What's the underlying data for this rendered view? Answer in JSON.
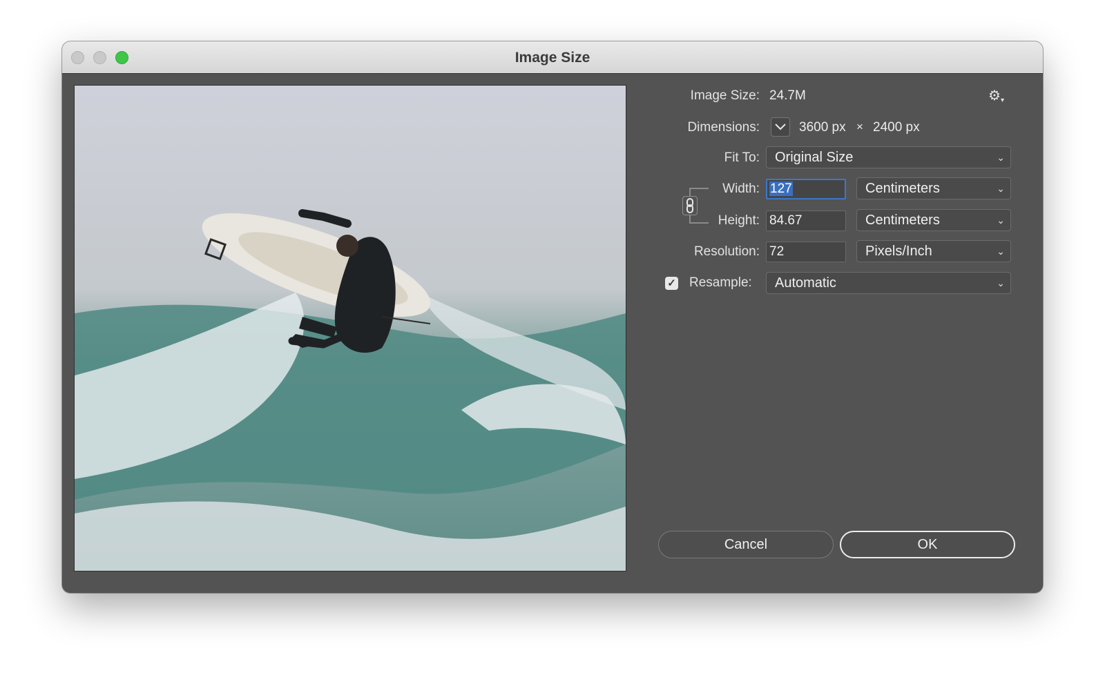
{
  "window": {
    "title": "Image Size",
    "controls": [
      "close-button",
      "minimize-button",
      "zoom-button"
    ]
  },
  "settings": {
    "image_size_label": "Image Size:",
    "image_size_value": "24.7M",
    "gear_icon": "gear-icon",
    "dimensions_label": "Dimensions:",
    "dimensions_width": "3600 px",
    "dimensions_times": "×",
    "dimensions_height": "2400 px",
    "fit_to_label": "Fit To:",
    "fit_to_value": "Original Size",
    "width_label": "Width:",
    "width_value": "127",
    "width_unit": "Centimeters",
    "height_label": "Height:",
    "height_value": "84.67",
    "height_unit": "Centimeters",
    "resolution_label": "Resolution:",
    "resolution_value": "72",
    "resolution_unit": "Pixels/Inch",
    "resample_label": "Resample:",
    "resample_checked": true,
    "resample_value": "Automatic",
    "constrain_icon": "link-icon"
  },
  "buttons": {
    "cancel": "Cancel",
    "ok": "OK"
  },
  "colors": {
    "panel_bg": "#535353",
    "focus_ring": "#3b78c9",
    "zoom_green": "#3fc548"
  }
}
